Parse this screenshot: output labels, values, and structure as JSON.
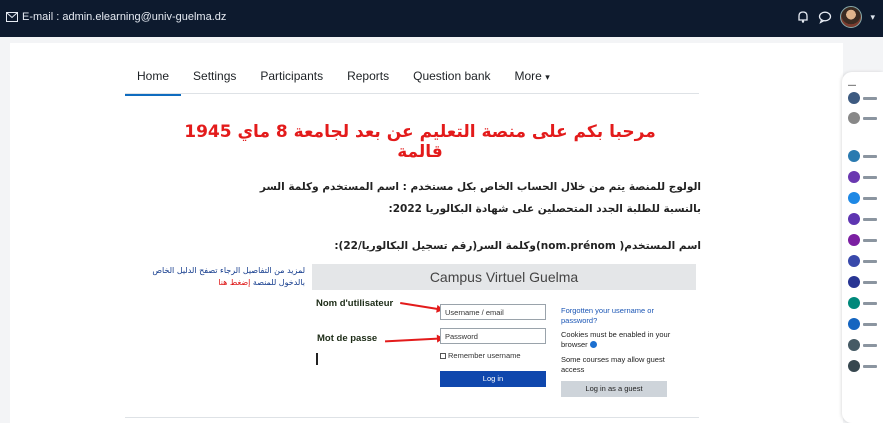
{
  "topbar": {
    "email_label": "E-mail : admin.elearning@univ-guelma.dz"
  },
  "nav": {
    "tabs": [
      "Home",
      "Settings",
      "Participants",
      "Reports",
      "Question bank",
      "More"
    ],
    "active_tab": "Home"
  },
  "content": {
    "title": "مرحبا بكم على منصة التعليم عن بعد لجامعة 8 ماي 1945 قالمة",
    "line1": "الولوج للمنصة يتم من خلال الحساب الخاص بكل مستخدم : اسم المستخدم وكلمة السر",
    "line2": "بالنسبة للطلبة الجدد المتحصلين على شهادة البكالوريا 2022:",
    "line3": "اسم المستخدم( nom.prénom)وكلمة السر(رقم تسجيل البكالوريا/22):",
    "help_line1": "لمزيد من التفاصيل الرجاء تصفح الدليل الخاص",
    "help_line2_prefix": "بالدخول للمنصة",
    "help_link": "إضغط هنا"
  },
  "login": {
    "heading": "Campus Virtuel Guelma",
    "username_caption": "Nom d'utilisateur",
    "password_caption": "Mot de passe",
    "username_placeholder": "Username / email",
    "password_placeholder": "Password",
    "remember_label": "Remember username",
    "login_button": "Log in",
    "forgot_link": "Forgotten your username or password?",
    "cookies_text": "Cookies must be enabled in your browser",
    "guest_text": "Some courses may allow guest access",
    "guest_button": "Log in as a guest"
  },
  "colors": {
    "topbar": "#0d1a2e",
    "accent": "#0f6cbf",
    "title_red": "#e31b1b",
    "login_button": "#0f47ad"
  },
  "icons": [
    "mail-icon",
    "bell-icon",
    "chat-icon",
    "user-avatar",
    "chevron-down-icon",
    "help-icon"
  ]
}
